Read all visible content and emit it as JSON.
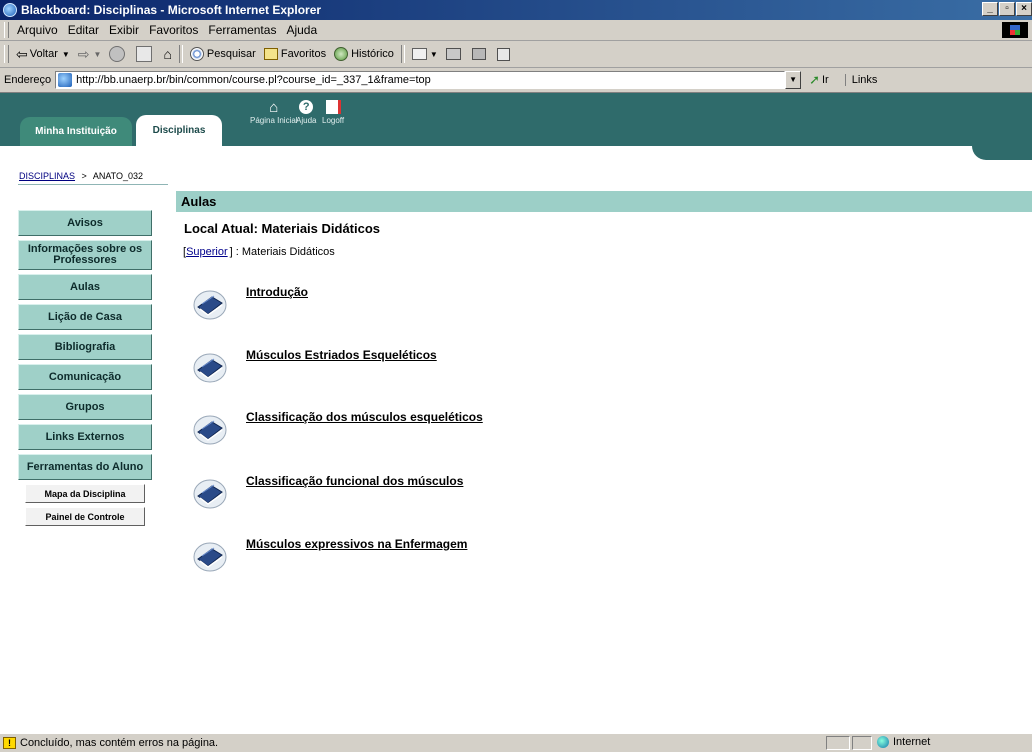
{
  "window": {
    "title": "Blackboard: Disciplinas - Microsoft Internet Explorer"
  },
  "menubar": {
    "items": [
      "Arquivo",
      "Editar",
      "Exibir",
      "Favoritos",
      "Ferramentas",
      "Ajuda"
    ]
  },
  "toolbar": {
    "back_label": "Voltar",
    "search_label": "Pesquisar",
    "favorites_label": "Favoritos",
    "history_label": "Histórico"
  },
  "addressbar": {
    "label": "Endereço",
    "url": "http://bb.unaerp.br/bin/common/course.pl?course_id=_337_1&frame=top",
    "go_label": "Ir",
    "links_label": "Links"
  },
  "bb": {
    "tab_institution": "Minha Instituição",
    "tab_courses": "Disciplinas",
    "home_label": "Página Inicial",
    "help_label": "Ajuda",
    "logoff_label": "Logoff"
  },
  "breadcrumb": {
    "root": "DISCIPLINAS",
    "separator": ">",
    "current": "ANATO_032"
  },
  "nav": {
    "items": [
      "Avisos",
      "Informações sobre os Professores",
      "Aulas",
      "Lição de Casa",
      "Bibliografia",
      "Comunicação",
      "Grupos",
      "Links Externos",
      "Ferramentas do Aluno"
    ],
    "sub": [
      "Mapa da Disciplina",
      "Painel de Controle"
    ]
  },
  "main": {
    "header": "Aulas",
    "current_location": "Local Atual: Materiais Didáticos",
    "subpath_open": "[",
    "subpath_link": "Superior",
    "subpath_close": "] : Materiais Didáticos",
    "items": [
      "Introdução",
      "Músculos Estriados Esqueléticos",
      "Classificação dos músculos esqueléticos",
      "Classificação funcional dos músculos",
      "Músculos expressivos na Enfermagem"
    ]
  },
  "status": {
    "message": "Concluído, mas contém erros na página.",
    "zone": "Internet"
  }
}
